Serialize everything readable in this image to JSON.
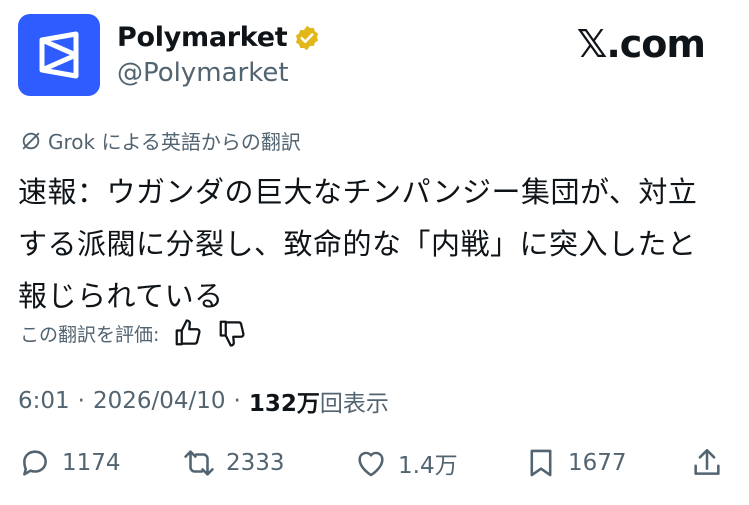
{
  "header": {
    "display_name": "Polymarket",
    "handle": "@Polymarket",
    "brand": "𝕏.com"
  },
  "translation_note": "Grok による英語からの翻訳",
  "tweet": {
    "text": "速報：ウガンダの巨大なチンパンジー集団が、対立する派閥に分裂し、致命的な「内戦」に突入したと報じられている"
  },
  "rate": {
    "label": "この翻訳を評価:"
  },
  "meta": {
    "time": "6:01",
    "sep1": "·",
    "date": "2026/04/10",
    "sep2": "·",
    "views": "132万",
    "views_label": "回表示"
  },
  "actions": {
    "replies": "1174",
    "reposts": "2333",
    "likes": "1.4万",
    "bookmarks": "1677"
  },
  "colors": {
    "avatar_bg": "#2e5cff",
    "verified": "#e2b719",
    "muted": "#536471",
    "text": "#0f1419"
  }
}
